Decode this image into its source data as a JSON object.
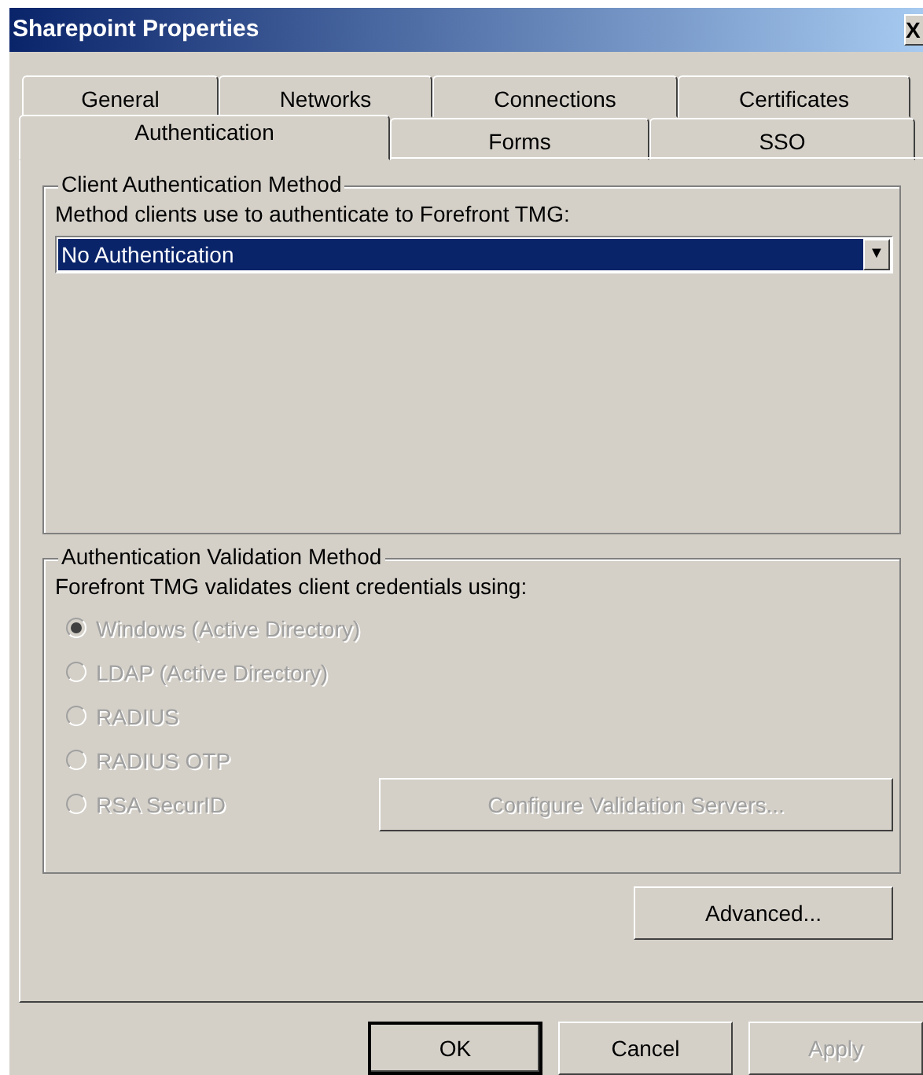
{
  "window": {
    "title": "Sharepoint Properties",
    "close_button": "X"
  },
  "tab_rows": [
    [
      {
        "label": "General",
        "selected": false
      },
      {
        "label": "Networks",
        "selected": false
      },
      {
        "label": "Connections",
        "selected": false
      },
      {
        "label": "Certificates",
        "selected": false
      }
    ],
    [
      {
        "label": "Authentication",
        "selected": true
      },
      {
        "label": "Forms",
        "selected": false
      },
      {
        "label": "SSO",
        "selected": false
      }
    ]
  ],
  "client_group": {
    "title": "Client Authentication Method",
    "prompt": "Method clients use to authenticate to Forefront TMG:",
    "dropdown": {
      "value": "No Authentication",
      "arrow": "▼"
    }
  },
  "validation_group": {
    "title": "Authentication Validation Method",
    "prompt": "Forefront TMG validates client credentials using:",
    "options": [
      {
        "label": "Windows (Active Directory)",
        "selected": true,
        "disabled": true
      },
      {
        "label": "LDAP (Active Directory)",
        "selected": false,
        "disabled": true
      },
      {
        "label": "RADIUS",
        "selected": false,
        "disabled": true
      },
      {
        "label": "RADIUS OTP",
        "selected": false,
        "disabled": true
      },
      {
        "label": "RSA SecurID",
        "selected": false,
        "disabled": true
      }
    ],
    "configure_button": {
      "label": "Configure Validation Servers...",
      "disabled": true
    }
  },
  "advanced_button": {
    "label": "Advanced...",
    "disabled": false
  },
  "buttons": [
    {
      "label": "OK",
      "default": true,
      "disabled": false
    },
    {
      "label": "Cancel",
      "default": false,
      "disabled": false
    },
    {
      "label": "Apply",
      "default": false,
      "disabled": true
    }
  ]
}
